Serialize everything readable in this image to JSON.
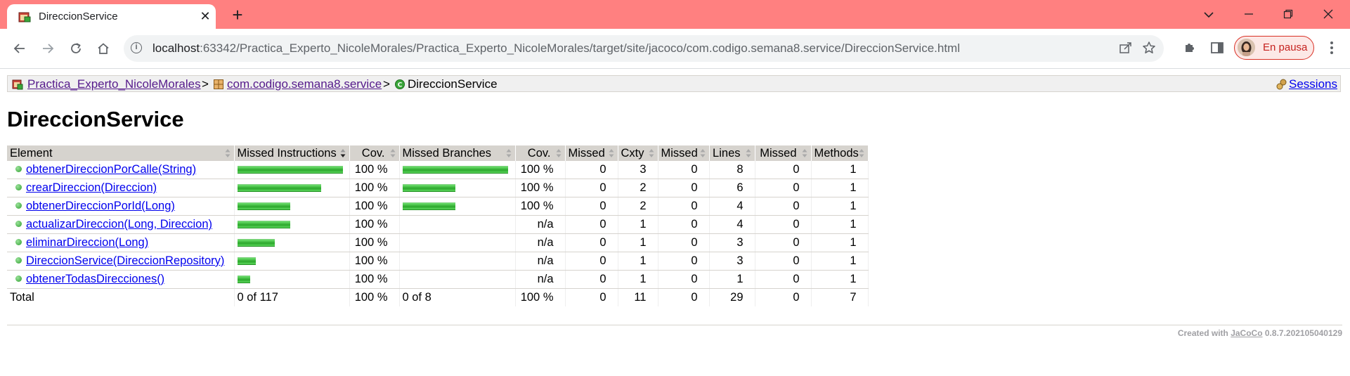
{
  "browser": {
    "tab_title": "DireccionService",
    "tab_close": "✕",
    "new_tab": "+",
    "url_host": "localhost",
    "url_rest": ":63342/Practica_Experto_NicoleMorales/Practica_Experto_NicoleMorales/target/site/jacoco/com.codigo.semana8.service/DireccionService.html",
    "profile_label": "En pausa",
    "tabstrip_color": "#ff8080",
    "icons": {
      "back": "arrow-left-icon",
      "forward": "arrow-right-icon",
      "reload": "reload-icon",
      "home": "home-icon",
      "site_info": "info-icon",
      "share": "share-icon",
      "bookmark": "star-icon",
      "extensions": "puzzle-icon",
      "side_panel": "side-panel-icon",
      "menu": "kebab-menu-icon"
    }
  },
  "breadcrumb": {
    "project": "Practica_Experto_NicoleMorales",
    "sep1": ">",
    "package": "com.codigo.semana8.service",
    "sep2": ">",
    "current": "DireccionService",
    "sessions": "Sessions"
  },
  "page_title": "DireccionService",
  "table": {
    "headers": [
      "Element",
      "Missed Instructions",
      "Cov.",
      "Missed Branches",
      "Cov.",
      "Missed",
      "Cxty",
      "Missed",
      "Lines",
      "Missed",
      "Methods"
    ],
    "rows": [
      {
        "element": "obtenerDireccionPorCalle(String)",
        "instr_coverage": 1.0,
        "instr_cov": "100 %",
        "branch_coverage": 1.0,
        "branch_cov": "100 %",
        "missed_cxty": "0",
        "cxty": "3",
        "missed_lines": "0",
        "lines": "8",
        "missed_methods": "0",
        "methods": "1"
      },
      {
        "element": "crearDireccion(Direccion)",
        "instr_coverage": 1.0,
        "instr_cov": "100 %",
        "branch_coverage": 1.0,
        "branch_cov": "100 %",
        "missed_cxty": "0",
        "cxty": "2",
        "missed_lines": "0",
        "lines": "6",
        "missed_methods": "0",
        "methods": "1"
      },
      {
        "element": "obtenerDireccionPorId(Long)",
        "instr_coverage": 1.0,
        "instr_cov": "100 %",
        "branch_coverage": 1.0,
        "branch_cov": "100 %",
        "missed_cxty": "0",
        "cxty": "2",
        "missed_lines": "0",
        "lines": "4",
        "missed_methods": "0",
        "methods": "1"
      },
      {
        "element": "actualizarDireccion(Long, Direccion)",
        "instr_coverage": 1.0,
        "instr_cov": "100 %",
        "branch_coverage": null,
        "branch_cov": "n/a",
        "missed_cxty": "0",
        "cxty": "1",
        "missed_lines": "0",
        "lines": "4",
        "missed_methods": "0",
        "methods": "1"
      },
      {
        "element": "eliminarDireccion(Long)",
        "instr_coverage": 1.0,
        "instr_cov": "100 %",
        "branch_coverage": null,
        "branch_cov": "n/a",
        "missed_cxty": "0",
        "cxty": "1",
        "missed_lines": "0",
        "lines": "3",
        "missed_methods": "0",
        "methods": "1"
      },
      {
        "element": "DireccionService(DireccionRepository)",
        "instr_coverage": 1.0,
        "instr_cov": "100 %",
        "branch_coverage": null,
        "branch_cov": "n/a",
        "missed_cxty": "0",
        "cxty": "1",
        "missed_lines": "0",
        "lines": "3",
        "missed_methods": "0",
        "methods": "1"
      },
      {
        "element": "obtenerTodasDirecciones()",
        "instr_coverage": 1.0,
        "instr_cov": "100 %",
        "branch_coverage": null,
        "branch_cov": "n/a",
        "missed_cxty": "0",
        "cxty": "1",
        "missed_lines": "0",
        "lines": "1",
        "missed_methods": "0",
        "methods": "1"
      }
    ],
    "instruction_bar_scale": [
      1.0,
      0.79,
      0.5,
      0.5,
      0.35,
      0.17,
      0.12
    ],
    "branch_bar_scale": [
      1.0,
      0.5,
      0.5,
      null,
      null,
      null,
      null
    ],
    "total": {
      "label": "Total",
      "missed_instr": "0 of 117",
      "instr_cov": "100 %",
      "missed_branches": "0 of 8",
      "branch_cov": "100 %",
      "missed_cxty": "0",
      "cxty": "11",
      "missed_lines": "0",
      "lines": "29",
      "missed_methods": "0",
      "methods": "7"
    },
    "bar_color": "#3cb93c"
  },
  "footer": {
    "prefix": "Created with ",
    "link": "JaCoCo",
    "version": " 0.8.7.202105040129"
  }
}
